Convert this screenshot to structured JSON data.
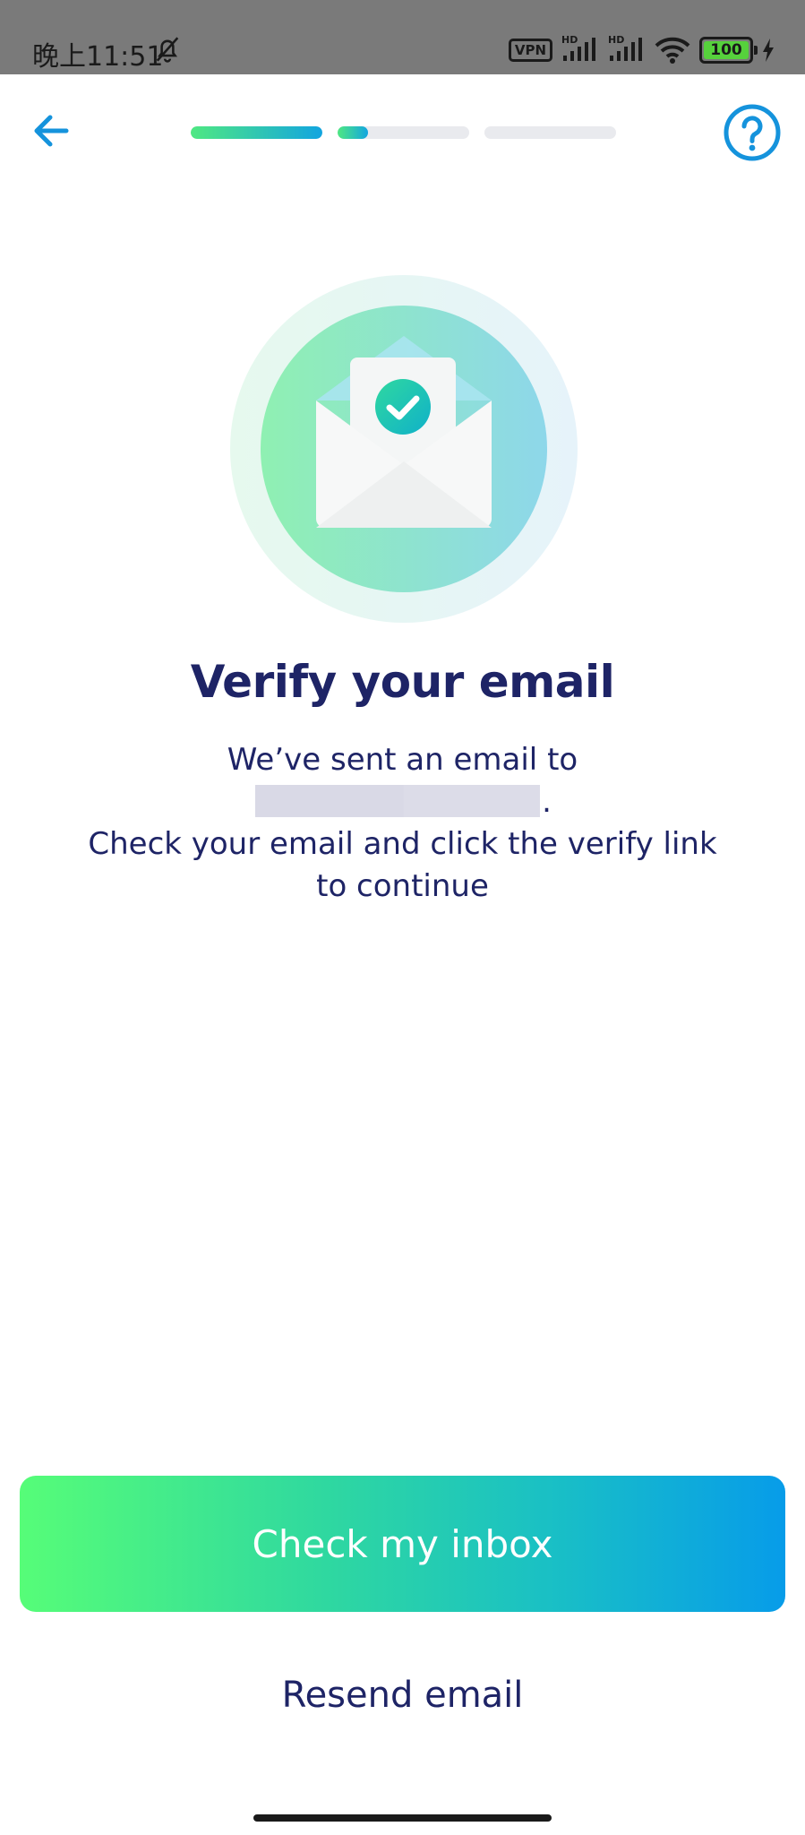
{
  "status_bar": {
    "time": "晚上11:51",
    "vpn_label": "VPN",
    "hd_label_1": "HD",
    "hd_label_2": "HD",
    "battery_level": "100"
  },
  "header": {
    "back_icon": "arrow-left-icon",
    "help_icon": "question-circle-icon",
    "progress": {
      "steps": [
        {
          "fill": 1.0
        },
        {
          "fill": 0.23
        },
        {
          "fill": 0.0
        }
      ]
    }
  },
  "illustration_icon": "envelope-check-icon",
  "main": {
    "title": "Verify your email",
    "message_prefix": "We’ve sent an email to",
    "message_suffix": ".",
    "message_line2": "Check your email and click the verify link to continue"
  },
  "actions": {
    "primary_label": "Check my inbox",
    "secondary_label": "Resend email"
  },
  "colors": {
    "accent_blue": "#1593dc",
    "title_navy": "#1e2466",
    "gradient_start": "#56fd78",
    "gradient_end": "#079ce9"
  }
}
